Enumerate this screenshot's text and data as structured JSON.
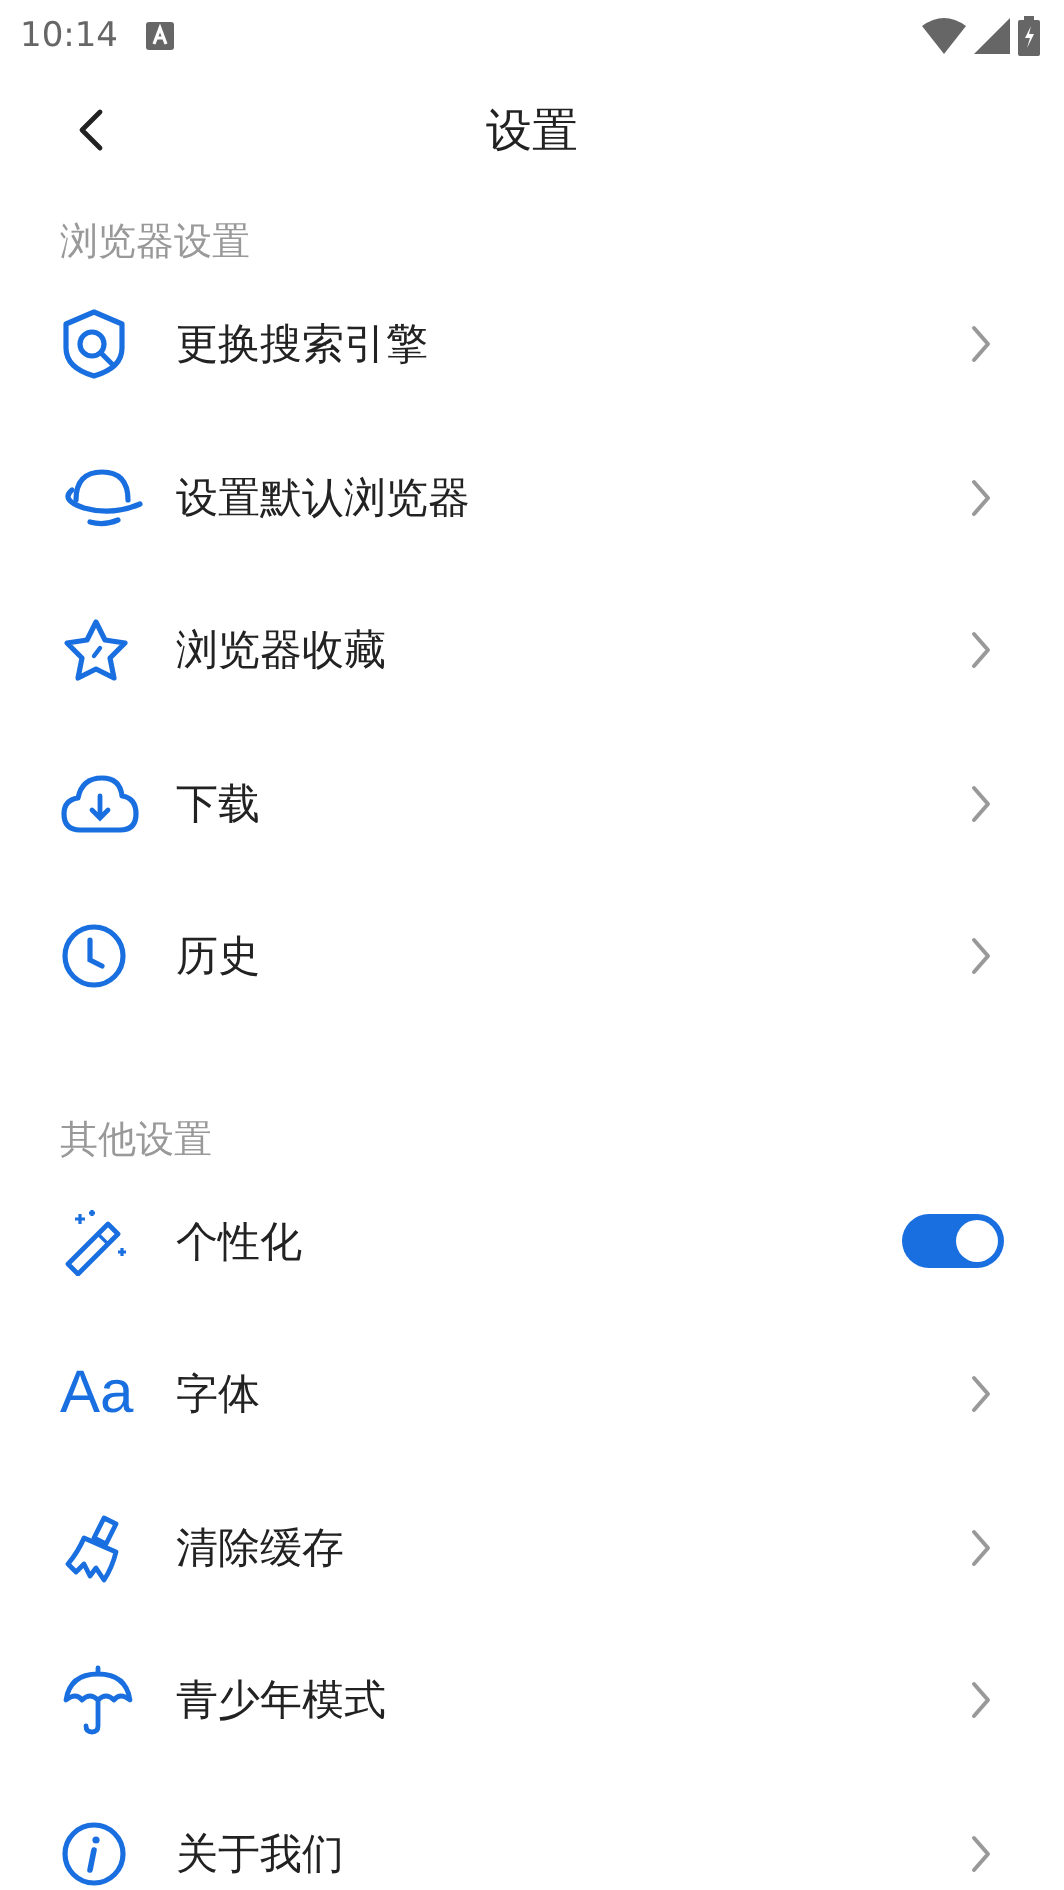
{
  "status_bar": {
    "time": "10:14"
  },
  "header": {
    "title": "设置"
  },
  "sections": [
    {
      "title": "浏览器设置",
      "items": [
        {
          "kind": "link",
          "label": "更换搜索引擎"
        },
        {
          "kind": "link",
          "label": "设置默认浏览器"
        },
        {
          "kind": "link",
          "label": "浏览器收藏"
        },
        {
          "kind": "link",
          "label": "下载"
        },
        {
          "kind": "link",
          "label": "历史"
        }
      ]
    },
    {
      "title": "其他设置",
      "items": [
        {
          "kind": "toggle",
          "label": "个性化",
          "on": true
        },
        {
          "kind": "link",
          "label": "字体",
          "glyph": "Aa"
        },
        {
          "kind": "link",
          "label": "清除缓存"
        },
        {
          "kind": "link",
          "label": "青少年模式"
        },
        {
          "kind": "link",
          "label": "关于我们"
        }
      ]
    }
  ]
}
